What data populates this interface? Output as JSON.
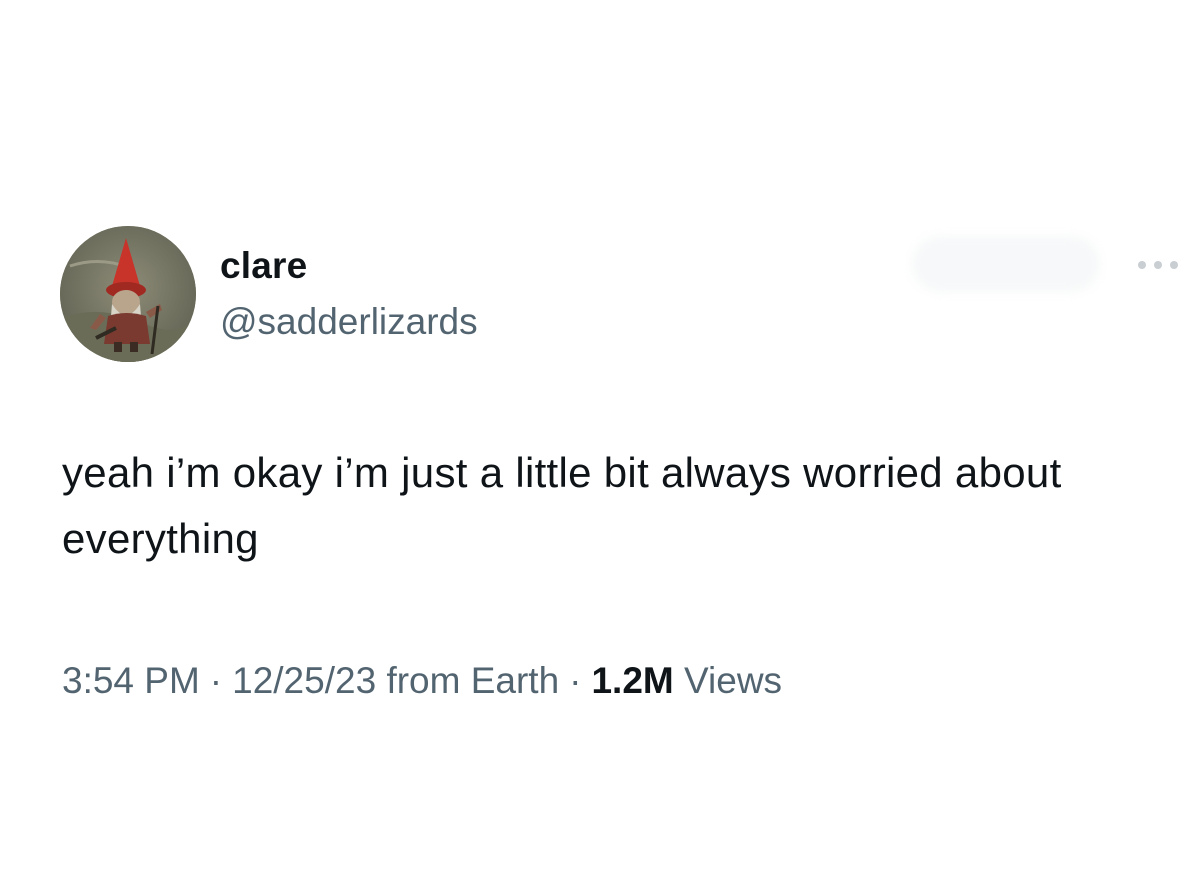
{
  "tweet": {
    "author": {
      "display_name": "clare",
      "handle": "@sadderlizards",
      "avatar_icon": "garden-gnome-avatar"
    },
    "text": "yeah i’m okay i’m just a little bit always worried about everything",
    "meta": {
      "time": "3:54 PM",
      "separator": "·",
      "date": "12/25/23",
      "source": "from Earth",
      "views_count": "1.2M",
      "views_label": "Views"
    },
    "more_icon": "more-horizontal-icon"
  },
  "colors": {
    "text_primary": "#0f1419",
    "text_secondary": "#536471",
    "background": "#ffffff"
  }
}
